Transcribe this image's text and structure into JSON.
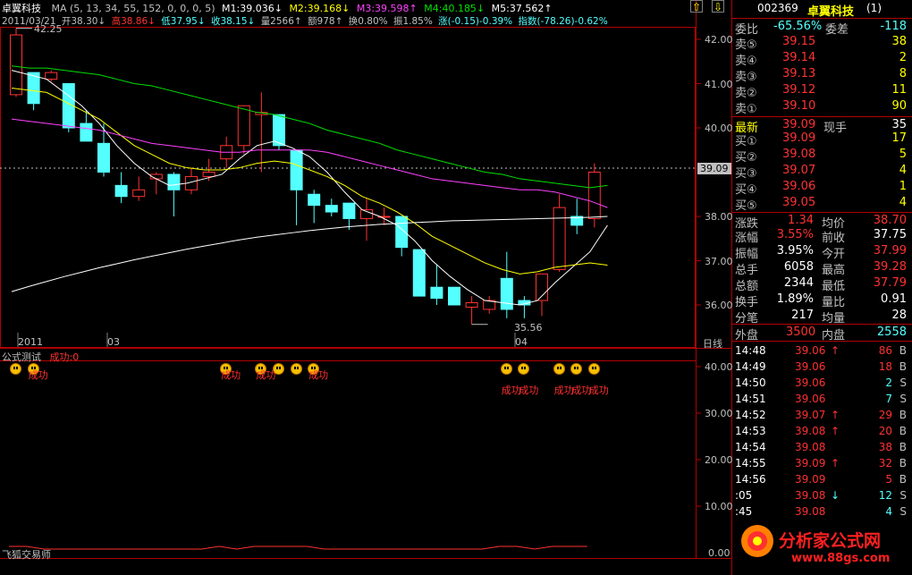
{
  "header": {
    "stock_name": "卓翼科技",
    "ma_params": "MA (5, 13, 34, 55, 152, 0, 0, 0, 5)",
    "m1": "M1:39.036↓",
    "m2": "M2:39.168↓",
    "m3": "M3:39.598↑",
    "m4": "M4:40.185↓",
    "m5": "M5:37.562↑",
    "date": "2011/03/21",
    "open": "开38.30↓",
    "high": "高38.86↓",
    "low": "低37.95↓",
    "close": "收38.15↓",
    "volume": "量2566↑",
    "amount": "额978↑",
    "turnover": "换0.80%",
    "amplitude": "振1.85%",
    "change": "涨(-0.15)-0.39%",
    "index": "指数(-78.26)-0.62%"
  },
  "colors": {
    "up": "#ff3232",
    "down": "#54ffff",
    "ma1": "#ffffff",
    "ma2": "#ffff00",
    "ma3": "#ff40ff",
    "ma4": "#00e000",
    "ma5": "#ffffff",
    "grid": "#b00000"
  },
  "price_axis": {
    "ticks": [
      "42.00",
      "41.00",
      "40.00",
      "38.00",
      "37.00",
      "36.00"
    ],
    "current": "39.09",
    "high_label": "42.25",
    "low_label": "35.56"
  },
  "time_axis": {
    "labels": [
      "2011",
      "03",
      "04"
    ],
    "period": "日线"
  },
  "indicator": {
    "title": "公式测试",
    "value_label": "成功:0",
    "ticks": [
      "40.00",
      "30.00",
      "20.00",
      "10.00",
      "0.00"
    ],
    "signal_text": "成功"
  },
  "footer_label": "飞狐交易师",
  "chart_data": {
    "type": "candlestick",
    "ylim": [
      35.6,
      42.3
    ],
    "candles": [
      {
        "o": 40.75,
        "h": 42.25,
        "l": 40.7,
        "c": 42.1
      },
      {
        "o": 41.25,
        "h": 41.25,
        "l": 40.4,
        "c": 40.55
      },
      {
        "o": 41.1,
        "h": 41.3,
        "l": 41.05,
        "c": 41.25
      },
      {
        "o": 41.0,
        "h": 41.0,
        "l": 39.9,
        "c": 40.0
      },
      {
        "o": 40.1,
        "h": 40.4,
        "l": 39.8,
        "c": 39.7
      },
      {
        "o": 39.65,
        "h": 40.1,
        "l": 38.9,
        "c": 39.0
      },
      {
        "o": 38.7,
        "h": 39.0,
        "l": 38.3,
        "c": 38.45
      },
      {
        "o": 38.45,
        "h": 38.9,
        "l": 38.35,
        "c": 38.6
      },
      {
        "o": 38.85,
        "h": 39.0,
        "l": 38.5,
        "c": 38.95
      },
      {
        "o": 38.95,
        "h": 39.0,
        "l": 38.0,
        "c": 38.6
      },
      {
        "o": 38.6,
        "h": 39.1,
        "l": 38.5,
        "c": 38.9
      },
      {
        "o": 38.9,
        "h": 39.3,
        "l": 38.8,
        "c": 39.0
      },
      {
        "o": 39.3,
        "h": 39.8,
        "l": 39.1,
        "c": 39.6
      },
      {
        "o": 39.6,
        "h": 40.3,
        "l": 39.4,
        "c": 40.5
      },
      {
        "o": 40.3,
        "h": 40.8,
        "l": 39.0,
        "c": 40.35
      },
      {
        "o": 40.3,
        "h": 40.3,
        "l": 39.5,
        "c": 39.6
      },
      {
        "o": 39.5,
        "h": 39.5,
        "l": 37.8,
        "c": 38.6
      },
      {
        "o": 38.5,
        "h": 38.6,
        "l": 37.85,
        "c": 38.25
      },
      {
        "o": 38.25,
        "h": 38.4,
        "l": 38.0,
        "c": 38.1
      },
      {
        "o": 38.3,
        "h": 38.3,
        "l": 37.7,
        "c": 37.95
      },
      {
        "o": 37.95,
        "h": 38.4,
        "l": 37.45,
        "c": 38.15
      },
      {
        "o": 38.0,
        "h": 38.2,
        "l": 37.8,
        "c": 38.0
      },
      {
        "o": 38.0,
        "h": 38.0,
        "l": 37.1,
        "c": 37.3
      },
      {
        "o": 37.25,
        "h": 37.25,
        "l": 36.2,
        "c": 36.2
      },
      {
        "o": 36.4,
        "h": 36.9,
        "l": 36.0,
        "c": 36.15
      },
      {
        "o": 36.4,
        "h": 36.4,
        "l": 36.0,
        "c": 36.0
      },
      {
        "o": 35.95,
        "h": 36.2,
        "l": 35.56,
        "c": 36.05
      },
      {
        "o": 35.9,
        "h": 36.2,
        "l": 35.8,
        "c": 36.1
      },
      {
        "o": 36.6,
        "h": 37.2,
        "l": 35.7,
        "c": 35.9
      },
      {
        "o": 36.1,
        "h": 36.2,
        "l": 35.7,
        "c": 36.0
      },
      {
        "o": 36.1,
        "h": 36.7,
        "l": 35.75,
        "c": 36.7
      },
      {
        "o": 36.8,
        "h": 38.5,
        "l": 36.75,
        "c": 38.2
      },
      {
        "o": 38.0,
        "h": 38.4,
        "l": 37.6,
        "c": 37.8
      },
      {
        "o": 37.95,
        "h": 39.2,
        "l": 37.75,
        "c": 39.0
      }
    ],
    "ma_series": [
      {
        "name": "M1",
        "values": [
          41.3,
          41.2,
          41.1,
          40.8,
          40.5,
          40.1,
          39.6,
          39.2,
          38.9,
          38.7,
          38.75,
          38.85,
          38.95,
          39.3,
          39.6,
          39.7,
          39.55,
          39.35,
          39.0,
          38.55,
          38.15,
          38.0,
          37.8,
          37.45,
          37.0,
          36.65,
          36.35,
          36.1,
          36.05,
          36.0,
          36.1,
          36.5,
          36.85,
          37.2,
          37.8
        ]
      },
      {
        "name": "M2",
        "values": [
          40.9,
          40.85,
          40.8,
          40.6,
          40.4,
          40.2,
          39.9,
          39.6,
          39.4,
          39.2,
          39.1,
          39.05,
          39.05,
          39.1,
          39.2,
          39.25,
          39.2,
          39.05,
          38.9,
          38.7,
          38.45,
          38.3,
          38.1,
          37.85,
          37.55,
          37.35,
          37.15,
          36.95,
          36.8,
          36.7,
          36.75,
          36.85,
          36.9,
          36.95,
          36.9
        ]
      },
      {
        "name": "M3",
        "values": [
          40.2,
          40.15,
          40.1,
          40.05,
          40.0,
          39.95,
          39.85,
          39.75,
          39.65,
          39.6,
          39.55,
          39.5,
          39.45,
          39.45,
          39.5,
          39.5,
          39.5,
          39.5,
          39.45,
          39.35,
          39.25,
          39.15,
          39.05,
          38.95,
          38.85,
          38.8,
          38.75,
          38.7,
          38.65,
          38.6,
          38.6,
          38.55,
          38.45,
          38.35,
          38.2
        ]
      },
      {
        "name": "M4",
        "values": [
          41.4,
          41.35,
          41.35,
          41.3,
          41.25,
          41.2,
          41.1,
          41.0,
          40.95,
          40.85,
          40.75,
          40.65,
          40.55,
          40.45,
          40.35,
          40.3,
          40.2,
          40.1,
          39.95,
          39.85,
          39.75,
          39.65,
          39.5,
          39.4,
          39.3,
          39.2,
          39.1,
          39.0,
          38.95,
          38.85,
          38.8,
          38.75,
          38.7,
          38.65,
          38.7
        ]
      },
      {
        "name": "M5",
        "values": [
          36.3,
          36.42,
          36.53,
          36.64,
          36.74,
          36.84,
          36.93,
          37.02,
          37.1,
          37.18,
          37.26,
          37.33,
          37.4,
          37.47,
          37.53,
          37.58,
          37.63,
          37.68,
          37.72,
          37.76,
          37.79,
          37.82,
          37.84,
          37.86,
          37.88,
          37.9,
          37.91,
          37.92,
          37.93,
          37.94,
          37.95,
          37.96,
          37.97,
          37.98,
          38.0
        ]
      }
    ],
    "signals": [
      {
        "i": 0,
        "text": false
      },
      {
        "i": 1,
        "text": true
      },
      {
        "i": 12,
        "text": true
      },
      {
        "i": 14,
        "text": true
      },
      {
        "i": 15,
        "text": false
      },
      {
        "i": 16,
        "text": false
      },
      {
        "i": 17,
        "text": true
      },
      {
        "i": 28,
        "text": true
      },
      {
        "i": 29,
        "text": true
      },
      {
        "i": 31,
        "text": true
      },
      {
        "i": 32,
        "text": true
      },
      {
        "i": 33,
        "text": true
      }
    ]
  },
  "quote": {
    "code": "002369",
    "name": "卓翼科技",
    "suffix": "(1)",
    "weibi_label": "委比",
    "weibi_value": "-65.56%",
    "weicha_label": "委差",
    "weicha_value": "-118",
    "asks": [
      {
        "label": "卖⑤",
        "price": "39.15",
        "vol": "38"
      },
      {
        "label": "卖④",
        "price": "39.14",
        "vol": "2"
      },
      {
        "label": "卖③",
        "price": "39.13",
        "vol": "8"
      },
      {
        "label": "卖②",
        "price": "39.12",
        "vol": "11"
      },
      {
        "label": "卖①",
        "price": "39.10",
        "vol": "90"
      }
    ],
    "latest_label": "最新",
    "latest_value": "39.09",
    "now_label": "现手",
    "now_value": "35",
    "bids": [
      {
        "label": "买①",
        "price": "39.09",
        "vol": "17"
      },
      {
        "label": "买②",
        "price": "39.08",
        "vol": "5"
      },
      {
        "label": "买③",
        "price": "39.07",
        "vol": "4"
      },
      {
        "label": "买④",
        "price": "39.06",
        "vol": "1"
      },
      {
        "label": "买⑤",
        "price": "39.05",
        "vol": "4"
      }
    ],
    "stats": [
      {
        "l1": "涨跌",
        "v1": "1.34",
        "c1": "#ff3232",
        "l2": "均价",
        "v2": "38.70",
        "c2": "#ff3232"
      },
      {
        "l1": "涨幅",
        "v1": "3.55%",
        "c1": "#ff3232",
        "l2": "前收",
        "v2": "37.75",
        "c2": "#ffffff"
      },
      {
        "l1": "振幅",
        "v1": "3.95%",
        "c1": "#ffffff",
        "l2": "今开",
        "v2": "37.99",
        "c2": "#ff3232"
      },
      {
        "l1": "总手",
        "v1": "6058",
        "c1": "#ffffff",
        "l2": "最高",
        "v2": "39.28",
        "c2": "#ff3232"
      },
      {
        "l1": "总额",
        "v1": "2344",
        "c1": "#ffffff",
        "l2": "最低",
        "v2": "37.79",
        "c2": "#ff3232"
      },
      {
        "l1": "换手",
        "v1": "1.89%",
        "c1": "#ffffff",
        "l2": "量比",
        "v2": "0.91",
        "c2": "#ffffff"
      },
      {
        "l1": "分笔",
        "v1": "217",
        "c1": "#ffffff",
        "l2": "均量",
        "v2": "28",
        "c2": "#ffffff"
      }
    ],
    "outer_label": "外盘",
    "outer_value": "3500",
    "inner_label": "内盘",
    "inner_value": "2558"
  },
  "ticks": [
    {
      "time": "14:48",
      "price": "39.06",
      "arrow": "↑",
      "vol": "86",
      "side": "B",
      "color": "#ff3232"
    },
    {
      "time": "14:49",
      "price": "39.06",
      "arrow": "",
      "vol": "18",
      "side": "B",
      "color": "#ff3232"
    },
    {
      "time": "14:50",
      "price": "39.06",
      "arrow": "",
      "vol": "2",
      "side": "S",
      "color": "#54ffff"
    },
    {
      "time": "14:51",
      "price": "39.06",
      "arrow": "",
      "vol": "7",
      "side": "S",
      "color": "#54ffff"
    },
    {
      "time": "14:52",
      "price": "39.07",
      "arrow": "↑",
      "vol": "29",
      "side": "B",
      "color": "#ff3232"
    },
    {
      "time": "14:53",
      "price": "39.08",
      "arrow": "↑",
      "vol": "20",
      "side": "B",
      "color": "#ff3232"
    },
    {
      "time": "14:54",
      "price": "39.08",
      "arrow": "",
      "vol": "38",
      "side": "B",
      "color": "#ff3232"
    },
    {
      "time": "14:55",
      "price": "39.09",
      "arrow": "↑",
      "vol": "32",
      "side": "B",
      "color": "#ff3232"
    },
    {
      "time": "14:56",
      "price": "39.09",
      "arrow": "",
      "vol": "5",
      "side": "B",
      "color": "#ff3232"
    },
    {
      "time": ":05",
      "price": "39.08",
      "arrow": "↓",
      "vol": "12",
      "side": "S",
      "color": "#54ffff"
    },
    {
      "time": ":45",
      "price": "39.08",
      "arrow": "",
      "vol": "4",
      "side": "S",
      "color": "#54ffff"
    }
  ],
  "watermark": {
    "brand": "分析家公式网",
    "url": "www.88gs.com"
  },
  "scroll_up_icon": "up-arrow-icon",
  "scroll_down_icon": "down-arrow-icon"
}
